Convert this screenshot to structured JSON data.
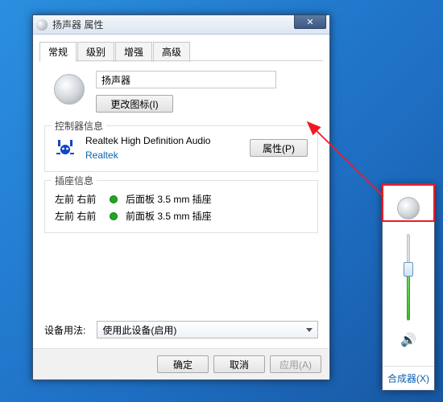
{
  "dialog": {
    "title": "扬声器 属性",
    "tabs": [
      "常规",
      "级别",
      "增强",
      "高级"
    ],
    "active_tab": 0,
    "device_name": "扬声器",
    "change_icon_label": "更改图标(I)",
    "controller_group_title": "控制器信息",
    "controller_name": "Realtek High Definition Audio",
    "controller_vendor": "Realtek",
    "controller_props_label": "属性(P)",
    "jack_group_title": "插座信息",
    "jacks": [
      {
        "lr": "左前 右前",
        "color": "green",
        "desc": "后面板 3.5 mm 插座"
      },
      {
        "lr": "左前 右前",
        "color": "green",
        "desc": "前面板 3.5 mm 插座"
      }
    ],
    "usage_label": "设备用法:",
    "usage_value": "使用此设备(启用)",
    "buttons": {
      "ok": "确定",
      "cancel": "取消",
      "apply": "应用(A)"
    }
  },
  "volume": {
    "level_percent": 58,
    "mixer_link": "合成器(X)"
  },
  "colors": {
    "annotation_red": "#ed1c24"
  }
}
